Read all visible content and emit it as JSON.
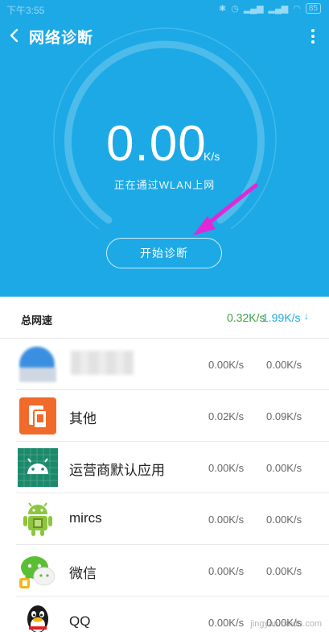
{
  "status_bar": {
    "time": "下午3:55",
    "battery": "85"
  },
  "header": {
    "title": "网络诊断"
  },
  "speed": {
    "value": "0.00",
    "unit": "K/s",
    "connection": "正在通过WLAN上网"
  },
  "start_button": {
    "label": "开始诊断"
  },
  "total": {
    "label": "总网速",
    "upload": "0.32K/s",
    "up_arrow": "↑",
    "download": "1.99K/s",
    "down_arrow": "↓"
  },
  "apps": [
    {
      "name": "",
      "icon": "blurred-app-icon",
      "upload": "0.00K/s",
      "download": "0.00K/s"
    },
    {
      "name": "其他",
      "icon": "other-app-icon",
      "upload": "0.02K/s",
      "download": "0.09K/s"
    },
    {
      "name": "运营商默认应用",
      "icon": "android-icon",
      "upload": "0.00K/s",
      "download": "0.00K/s"
    },
    {
      "name": "mircs",
      "icon": "android-robot-icon",
      "upload": "0.00K/s",
      "download": "0.00K/s"
    },
    {
      "name": "微信",
      "icon": "wechat-icon",
      "upload": "0.00K/s",
      "download": "0.00K/s"
    },
    {
      "name": "QQ",
      "icon": "qq-penguin-icon",
      "upload": "0.00K/s",
      "download": "0.00K/s"
    }
  ],
  "watermark": {
    "text": "jingyan.baidu.com"
  },
  "colors": {
    "primary": "#1ca9e6",
    "upload_green": "#3d9e3d",
    "arrow_magenta": "#e028d8"
  }
}
